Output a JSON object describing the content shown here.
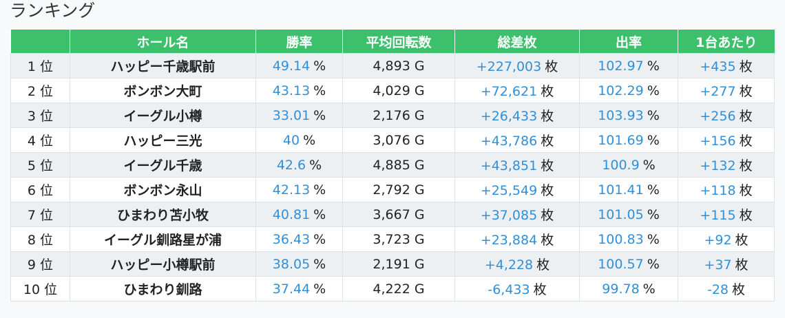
{
  "page_title": "ランキング",
  "columns": [
    "",
    "ホール名",
    "勝率",
    "平均回転数",
    "総差枚",
    "出率",
    "1台あたり"
  ],
  "rows": [
    {
      "rank": "1 位",
      "hall": "ハッピー千歳駅前",
      "win_rate": "49.14",
      "win_unit": "%",
      "avg_spins": "4,893 G",
      "total_diff": "+227,003",
      "total_unit": "枚",
      "payout": "102.97",
      "payout_unit": "%",
      "per_machine": "+435",
      "per_unit": "枚"
    },
    {
      "rank": "2 位",
      "hall": "ボンボン大町",
      "win_rate": "43.13",
      "win_unit": "%",
      "avg_spins": "4,029 G",
      "total_diff": "+72,621",
      "total_unit": "枚",
      "payout": "102.29",
      "payout_unit": "%",
      "per_machine": "+277",
      "per_unit": "枚"
    },
    {
      "rank": "3 位",
      "hall": "イーグル小樽",
      "win_rate": "33.01",
      "win_unit": "%",
      "avg_spins": "2,176 G",
      "total_diff": "+26,433",
      "total_unit": "枚",
      "payout": "103.93",
      "payout_unit": "%",
      "per_machine": "+256",
      "per_unit": "枚"
    },
    {
      "rank": "4 位",
      "hall": "ハッピー三光",
      "win_rate": "40",
      "win_unit": "%",
      "avg_spins": "3,076 G",
      "total_diff": "+43,786",
      "total_unit": "枚",
      "payout": "101.69",
      "payout_unit": "%",
      "per_machine": "+156",
      "per_unit": "枚"
    },
    {
      "rank": "5 位",
      "hall": "イーグル千歳",
      "win_rate": "42.6",
      "win_unit": "%",
      "avg_spins": "4,885 G",
      "total_diff": "+43,851",
      "total_unit": "枚",
      "payout": "100.9",
      "payout_unit": "%",
      "per_machine": "+132",
      "per_unit": "枚"
    },
    {
      "rank": "6 位",
      "hall": "ボンボン永山",
      "win_rate": "42.13",
      "win_unit": "%",
      "avg_spins": "2,792 G",
      "total_diff": "+25,549",
      "total_unit": "枚",
      "payout": "101.41",
      "payout_unit": "%",
      "per_machine": "+118",
      "per_unit": "枚"
    },
    {
      "rank": "7 位",
      "hall": "ひまわり苫小牧",
      "win_rate": "40.81",
      "win_unit": "%",
      "avg_spins": "3,667 G",
      "total_diff": "+37,085",
      "total_unit": "枚",
      "payout": "101.05",
      "payout_unit": "%",
      "per_machine": "+115",
      "per_unit": "枚"
    },
    {
      "rank": "8 位",
      "hall": "イーグル釧路星が浦",
      "win_rate": "36.43",
      "win_unit": "%",
      "avg_spins": "3,723 G",
      "total_diff": "+23,884",
      "total_unit": "枚",
      "payout": "100.83",
      "payout_unit": "%",
      "per_machine": "+92",
      "per_unit": "枚"
    },
    {
      "rank": "9 位",
      "hall": "ハッピー小樽駅前",
      "win_rate": "38.05",
      "win_unit": "%",
      "avg_spins": "2,191 G",
      "total_diff": "+4,228",
      "total_unit": "枚",
      "payout": "100.57",
      "payout_unit": "%",
      "per_machine": "+37",
      "per_unit": "枚"
    },
    {
      "rank": "10 位",
      "hall": "ひまわり釧路",
      "win_rate": "37.44",
      "win_unit": "%",
      "avg_spins": "4,222 G",
      "total_diff": "-6,433",
      "total_unit": "枚",
      "payout": "99.78",
      "payout_unit": "%",
      "per_machine": "-28",
      "per_unit": "枚"
    }
  ],
  "colors": {
    "header_bg": "#3dc06c",
    "header_text": "#ffffff",
    "value_blue": "#2f8fd8",
    "stripe": "#edf0f2"
  }
}
